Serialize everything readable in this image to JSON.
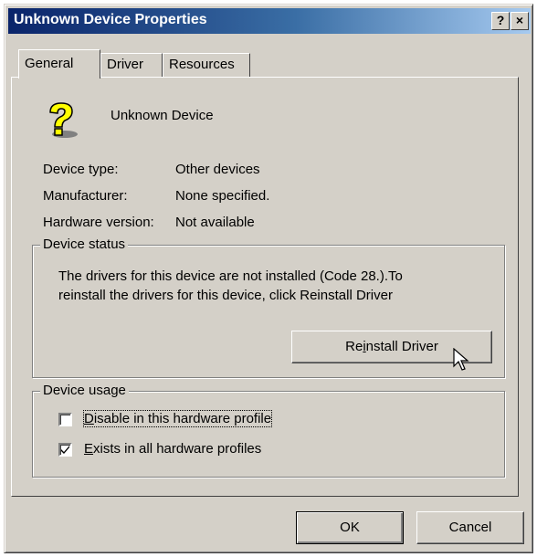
{
  "window": {
    "title": "Unknown Device Properties",
    "help_button": "?",
    "close_button": "×"
  },
  "tabs": [
    {
      "label": "General",
      "active": true
    },
    {
      "label": "Driver",
      "active": false
    },
    {
      "label": "Resources",
      "active": false
    }
  ],
  "device": {
    "icon": "question-mark-device-icon",
    "name": "Unknown Device"
  },
  "properties": [
    {
      "label": "Device type:",
      "value": "Other devices"
    },
    {
      "label": "Manufacturer:",
      "value": "None specified."
    },
    {
      "label": "Hardware version:",
      "value": "Not available"
    }
  ],
  "status": {
    "group_title": "Device status",
    "line1": "The drivers for this device are not installed  (Code 28.).To",
    "line2": "reinstall the drivers for this device, click Reinstall Driver",
    "button_pre": "Re",
    "button_accel": "i",
    "button_post": "nstall Driver"
  },
  "usage": {
    "group_title": "Device usage",
    "disable": {
      "accel": "D",
      "rest": "isable in this hardware profile",
      "checked": false
    },
    "exists": {
      "accel": "E",
      "rest": "xists in all hardware profiles",
      "checked": true
    }
  },
  "footer": {
    "ok_label": "OK",
    "cancel_label": "Cancel"
  },
  "colors": {
    "title_bar_start": "#0a246a",
    "title_bar_end": "#a6caf0",
    "face": "#d4d0c8",
    "icon_yellow": "#ffff00"
  }
}
